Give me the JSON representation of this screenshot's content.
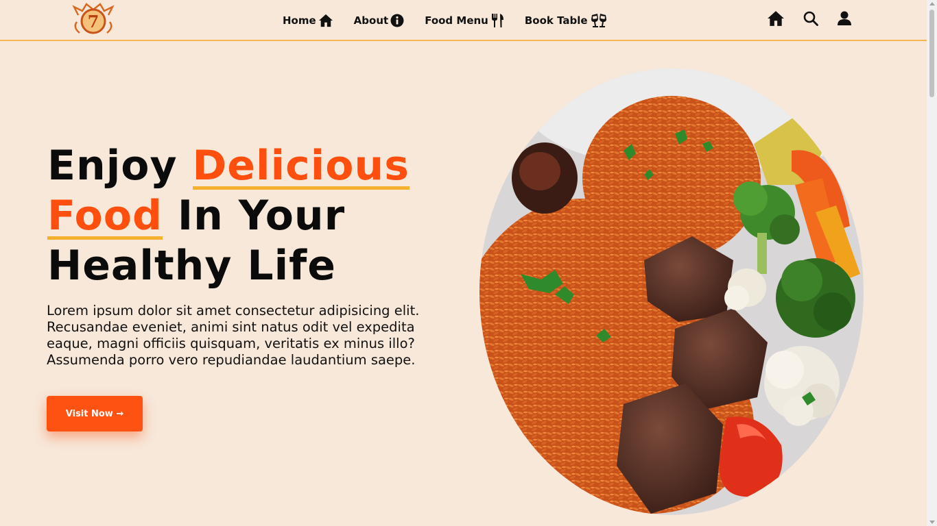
{
  "header": {
    "logo_icon": "crown-7-logo",
    "logo_text": "7",
    "nav": [
      {
        "label": "Home",
        "icon": "home-icon"
      },
      {
        "label": "About",
        "icon": "info-icon"
      },
      {
        "label": "Food Menu",
        "icon": "utensils-icon"
      },
      {
        "label": "Book Table",
        "icon": "cheers-icon"
      }
    ],
    "actions": [
      "home-icon",
      "search-icon",
      "user-icon"
    ]
  },
  "hero": {
    "title_part1": "Enjoy ",
    "title_accent1": "Delicious",
    "title_accent2": "Food",
    "title_part2": " In Your",
    "title_part3": "Healthy Life",
    "paragraph": "Lorem ipsum dolor sit amet consectetur adipisicing elit. Recusandae eveniet, animi sint natus odit vel expedita eaque, magni officiis quisquam, veritatis ex minus illo? Assumenda porro vero repudiandae laudantium saepe.",
    "cta_label": "Visit Now →"
  },
  "colors": {
    "background": "#f7e8da",
    "accent": "#ff4f0f",
    "underline": "#f5b02e",
    "button": "#fd5212"
  }
}
